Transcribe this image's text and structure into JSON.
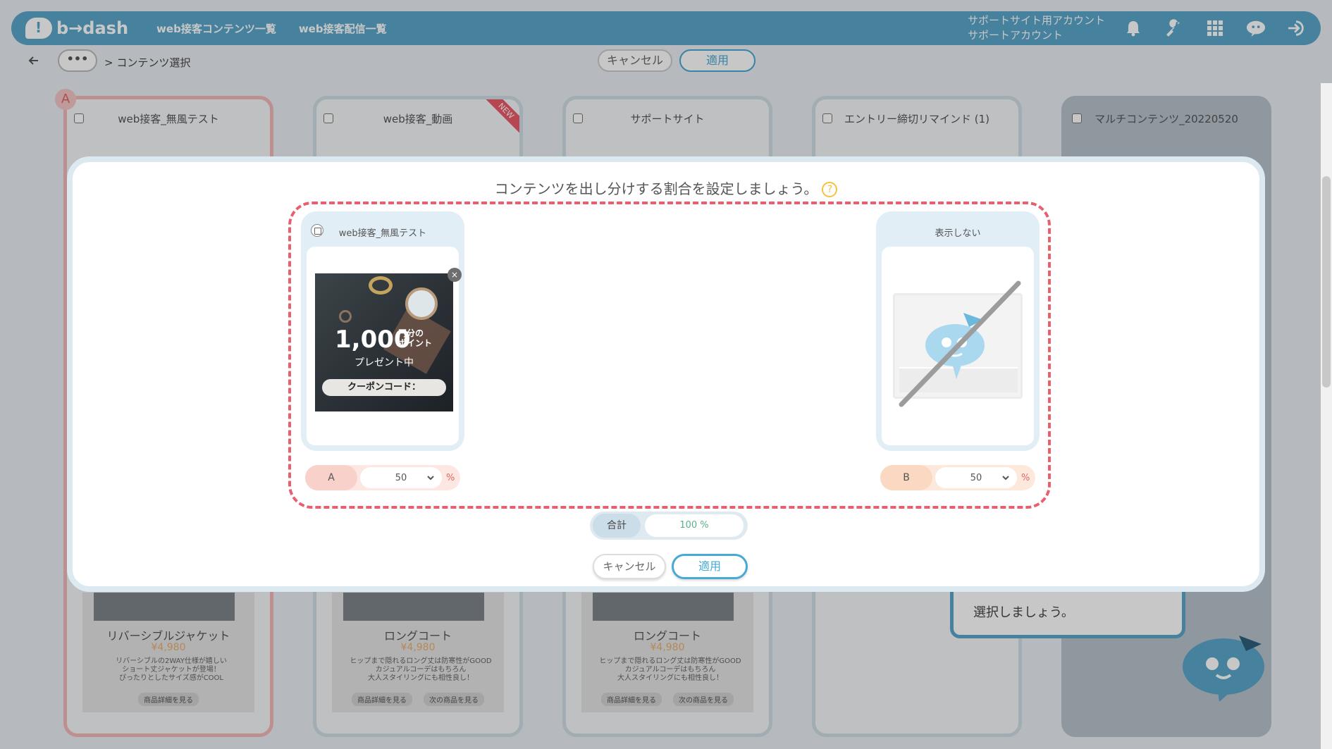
{
  "header": {
    "logo_text": "b→dash",
    "nav": [
      "web接客コンテンツ一覧",
      "web接客配信一覧"
    ],
    "account_line1": "サポートサイト用アカウント",
    "account_line2": "サポートアカウント",
    "icons": [
      "bell-icon",
      "wrench-icon",
      "grid-icon",
      "mascot-cloud-icon",
      "logout-icon"
    ]
  },
  "subbar": {
    "dots": "•••",
    "breadcrumb": "> コンテンツ選択",
    "cancel_label": "キャンセル",
    "apply_label": "適用"
  },
  "cards": [
    {
      "title": "web接客_無風テスト",
      "badge": "A",
      "product": "リバーシブルジャケット",
      "price": "¥4,980",
      "desc": [
        "リバーシブルの2WAY仕様が嬉しい",
        "ショート丈ジャケットが登場！",
        "ぴったりとしたサイズ感がCOOL"
      ],
      "buttons": [
        "商品詳細を見る"
      ]
    },
    {
      "title": "web接客_動画",
      "ribbon": "NEW",
      "product": "ロングコート",
      "price": "¥4,980",
      "desc": [
        "ヒップまで隠れるロング丈は防寒性がGOOD",
        "カジュアルコーデはもちろん",
        "大人スタイリングにも相性良し！"
      ],
      "buttons": [
        "商品詳細を見る",
        "次の商品を見る"
      ]
    },
    {
      "title": "サポートサイト",
      "product": "ロングコート",
      "price": "¥4,980",
      "desc": [
        "ヒップまで隠れるロング丈は防寒性がGOOD",
        "カジュアルコーデはもちろん",
        "大人スタイリングにも相性良し！"
      ],
      "buttons": [
        "商品詳細を見る",
        "次の商品を見る"
      ]
    },
    {
      "title": "エントリー締切リマインド (1)"
    },
    {
      "title": "マルチコンテンツ_20220520"
    }
  ],
  "tooltip": {
    "text": "選択しましょう。"
  },
  "modal": {
    "title": "コンテンツを出し分けする割合を設定しましょう。",
    "help": "?",
    "left_card": {
      "title": "web接客_無風テスト",
      "banner_big": "1,000",
      "banner_small1": "円分の",
      "banner_small2": "ポイント",
      "banner_present": "プレゼント中",
      "banner_coupon": "クーポンコード：",
      "close": "×"
    },
    "right_card": {
      "title": "表示しない"
    },
    "ratio_a": {
      "label": "A",
      "value": "50",
      "unit": "%"
    },
    "ratio_b": {
      "label": "B",
      "value": "50",
      "unit": "%"
    },
    "total": {
      "label": "合計",
      "value": "100 %"
    },
    "cancel_label": "キャンセル",
    "apply_label": "適用"
  }
}
